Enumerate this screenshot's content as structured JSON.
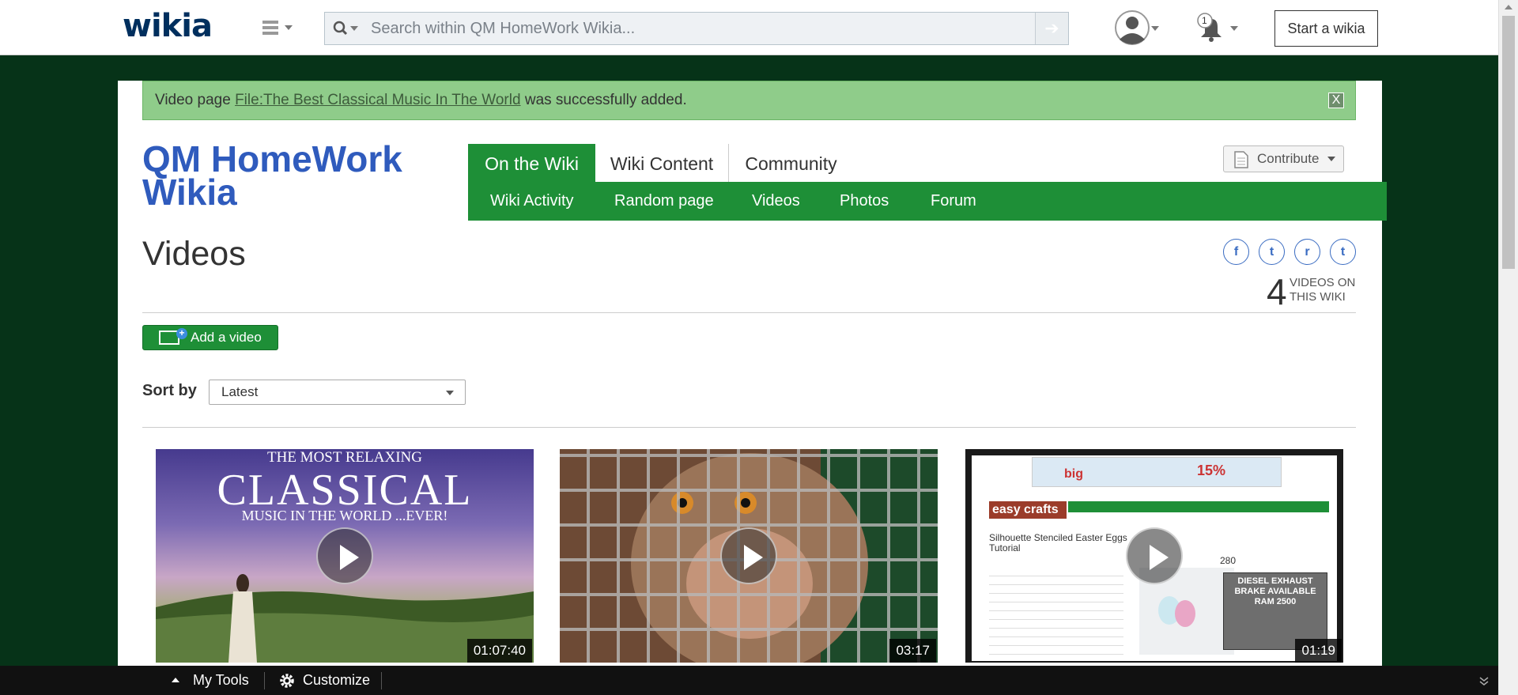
{
  "global_nav": {
    "logo": "wikia",
    "search_placeholder": "Search within QM HomeWork Wikia...",
    "search_go": "➔",
    "notification_count": "1",
    "start_wiki_label": "Start a wikia"
  },
  "notice": {
    "prefix": "Video page ",
    "link": "File:The Best Classical Music In The World",
    "suffix": " was successfully added.",
    "close": "X"
  },
  "wiki": {
    "name": "QM HomeWork Wikia",
    "tabs": [
      "On the Wiki",
      "Wiki Content",
      "Community"
    ],
    "subnav": [
      "Wiki Activity",
      "Random page",
      "Videos",
      "Photos",
      "Forum"
    ],
    "contribute_label": "Contribute"
  },
  "page": {
    "title": "Videos",
    "share": [
      "f",
      "t",
      "r",
      "t"
    ],
    "video_count": "4",
    "video_count_label_1": "VIDEOS ON",
    "video_count_label_2": "THIS WIKI",
    "add_video_label": "Add a video",
    "sort_label": "Sort by",
    "sort_value": "Latest"
  },
  "videos": [
    {
      "title_line1": "THE MOST RELAXING",
      "title_line2": "CLASSICAL",
      "title_line3": "MUSIC IN THE WORLD ...EVER!",
      "duration": "01:07:40"
    },
    {
      "duration": "03:17"
    },
    {
      "site": "easy crafts",
      "heading": "Silhouette Stenciled Easter Eggs Tutorial",
      "ad_price": "15%",
      "ad_brand": "big",
      "ad_truck": "DIESEL EXHAUST BRAKE AVAILABLE RAM 2500",
      "count": "280",
      "duration": "01:19"
    }
  ],
  "toolbar": {
    "my_tools": "My Tools",
    "customize": "Customize"
  }
}
